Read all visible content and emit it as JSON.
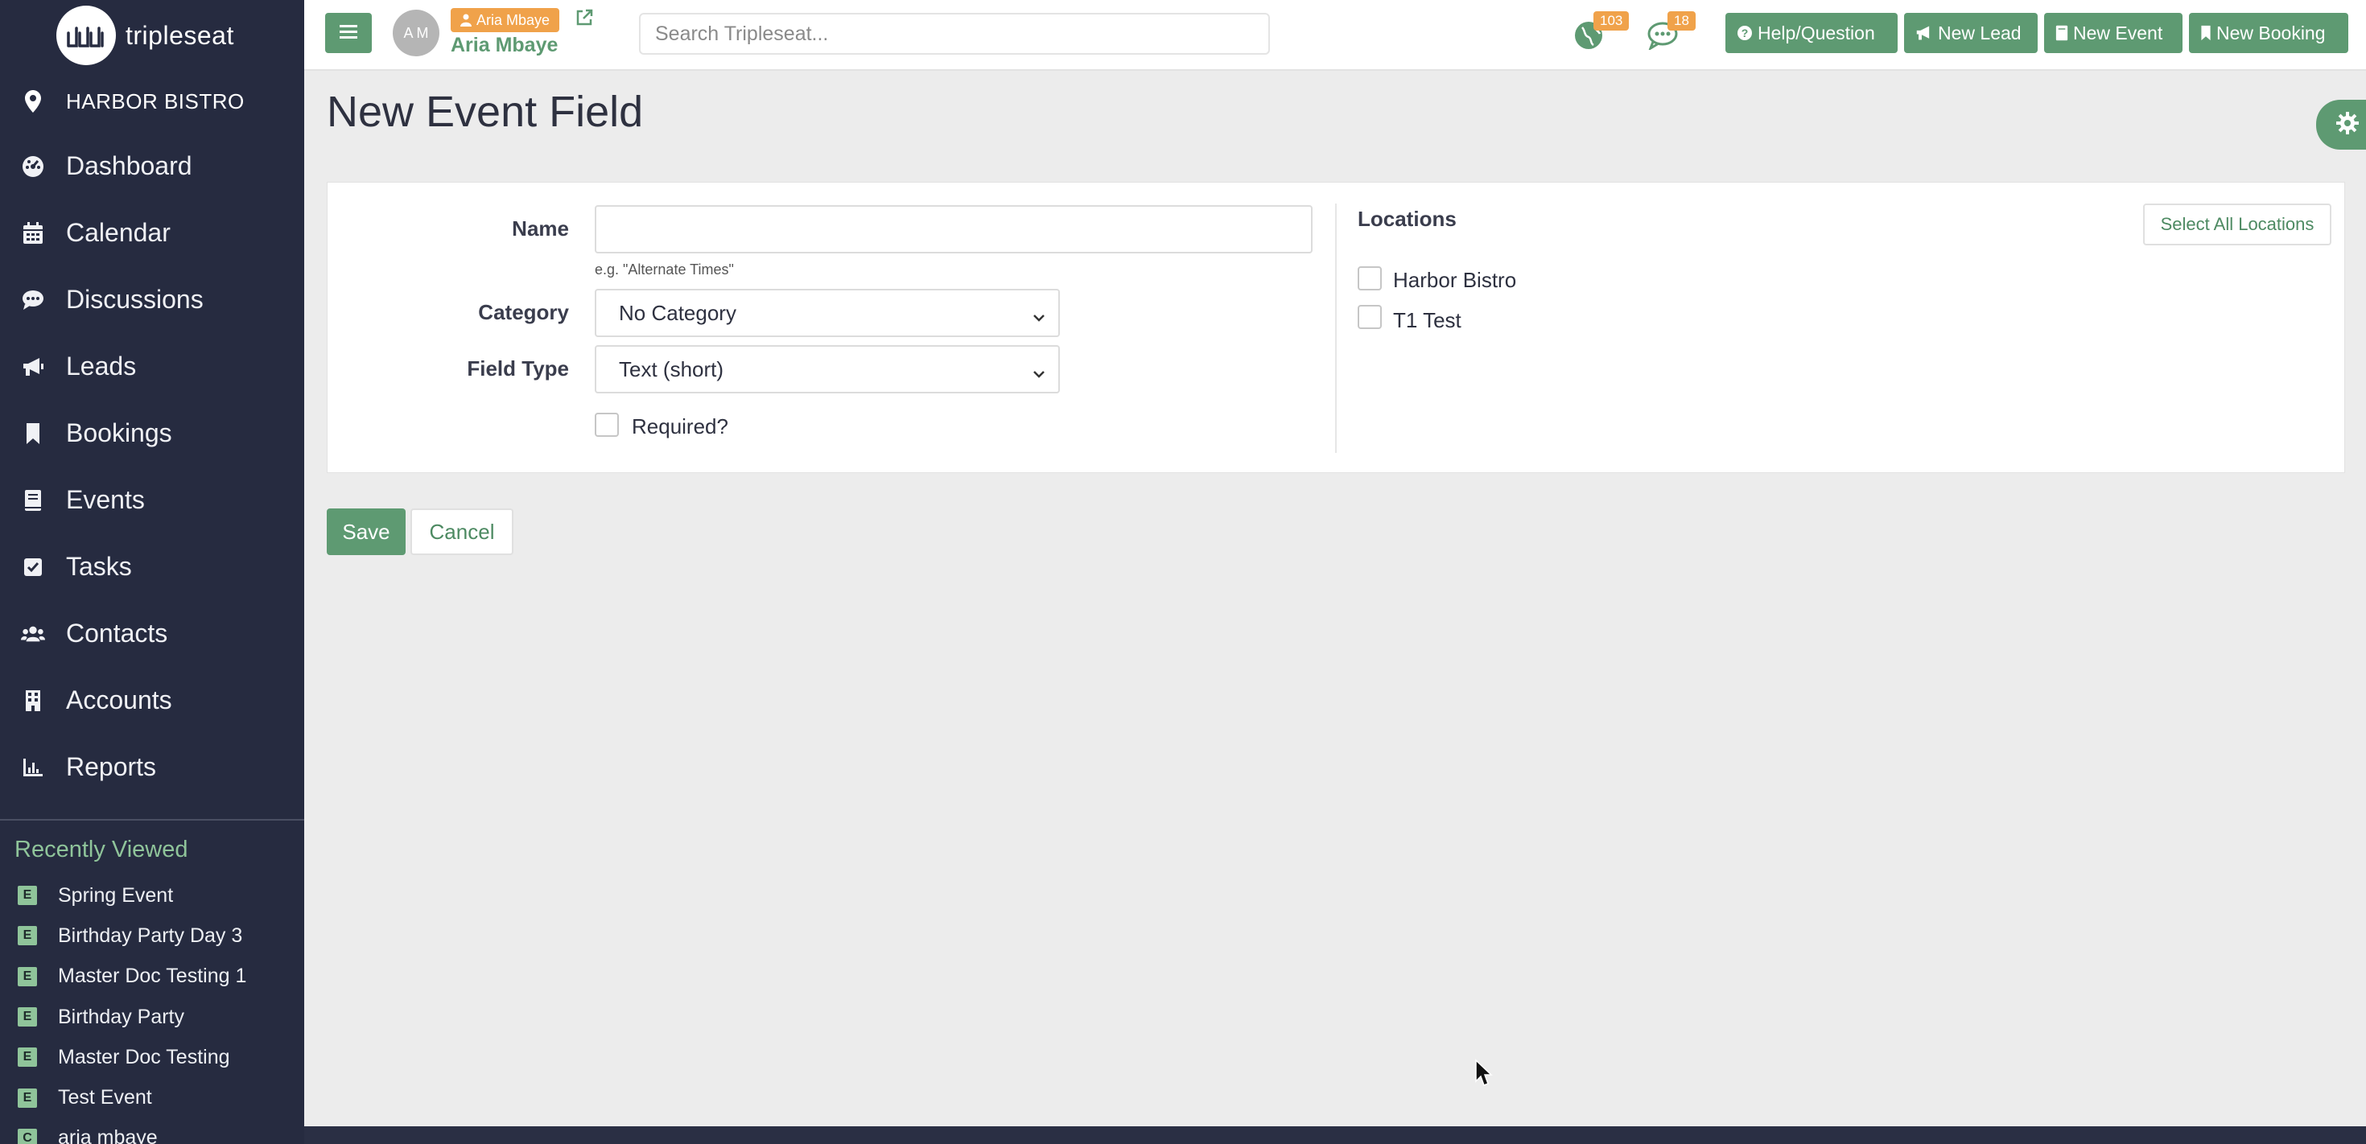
{
  "brand": {
    "name": "tripleseat"
  },
  "location": {
    "name": "HARBOR BISTRO"
  },
  "nav": [
    {
      "label": "Dashboard",
      "icon": "dashboard-icon"
    },
    {
      "label": "Calendar",
      "icon": "calendar-icon"
    },
    {
      "label": "Discussions",
      "icon": "chat-icon"
    },
    {
      "label": "Leads",
      "icon": "megaphone-icon"
    },
    {
      "label": "Bookings",
      "icon": "bookmark-icon"
    },
    {
      "label": "Events",
      "icon": "book-icon"
    },
    {
      "label": "Tasks",
      "icon": "checkbox-icon"
    },
    {
      "label": "Contacts",
      "icon": "users-icon"
    },
    {
      "label": "Accounts",
      "icon": "building-icon"
    },
    {
      "label": "Reports",
      "icon": "bar-chart-icon"
    }
  ],
  "recent": {
    "title": "Recently Viewed",
    "items": [
      {
        "badge": "E",
        "label": "Spring Event"
      },
      {
        "badge": "E",
        "label": "Birthday Party Day 3"
      },
      {
        "badge": "E",
        "label": "Master Doc Testing 1"
      },
      {
        "badge": "E",
        "label": "Birthday Party"
      },
      {
        "badge": "E",
        "label": "Master Doc Testing"
      },
      {
        "badge": "E",
        "label": "Test Event"
      },
      {
        "badge": "C",
        "label": "aria mbaye"
      }
    ]
  },
  "topbar": {
    "avatar_initials": "A M",
    "user_tag": "Aria Mbaye",
    "user_name": "Aria Mbaye",
    "search_placeholder": "Search Tripleseat...",
    "notifications": {
      "globe_count": "103",
      "chat_count": "18"
    },
    "buttons": {
      "help": "Help/Question",
      "new_lead": "New Lead",
      "new_event": "New Event",
      "new_booking": "New Booking"
    }
  },
  "page": {
    "title": "New Event Field"
  },
  "form": {
    "name_label": "Name",
    "name_value": "",
    "name_hint": "e.g. \"Alternate Times\"",
    "category_label": "Category",
    "category_value": "No Category",
    "field_type_label": "Field Type",
    "field_type_value": "Text (short)",
    "required_label": "Required?",
    "required_checked": false
  },
  "locations": {
    "title": "Locations",
    "select_all_label": "Select All Locations",
    "items": [
      {
        "label": "Harbor Bistro",
        "checked": false
      },
      {
        "label": "T1 Test",
        "checked": false
      }
    ]
  },
  "actions": {
    "save": "Save",
    "cancel": "Cancel"
  },
  "colors": {
    "sidebar_bg": "#262b40",
    "accent_green": "#5e9a72",
    "badge_orange": "#f0a24a",
    "recent_green": "#8fc49a"
  }
}
